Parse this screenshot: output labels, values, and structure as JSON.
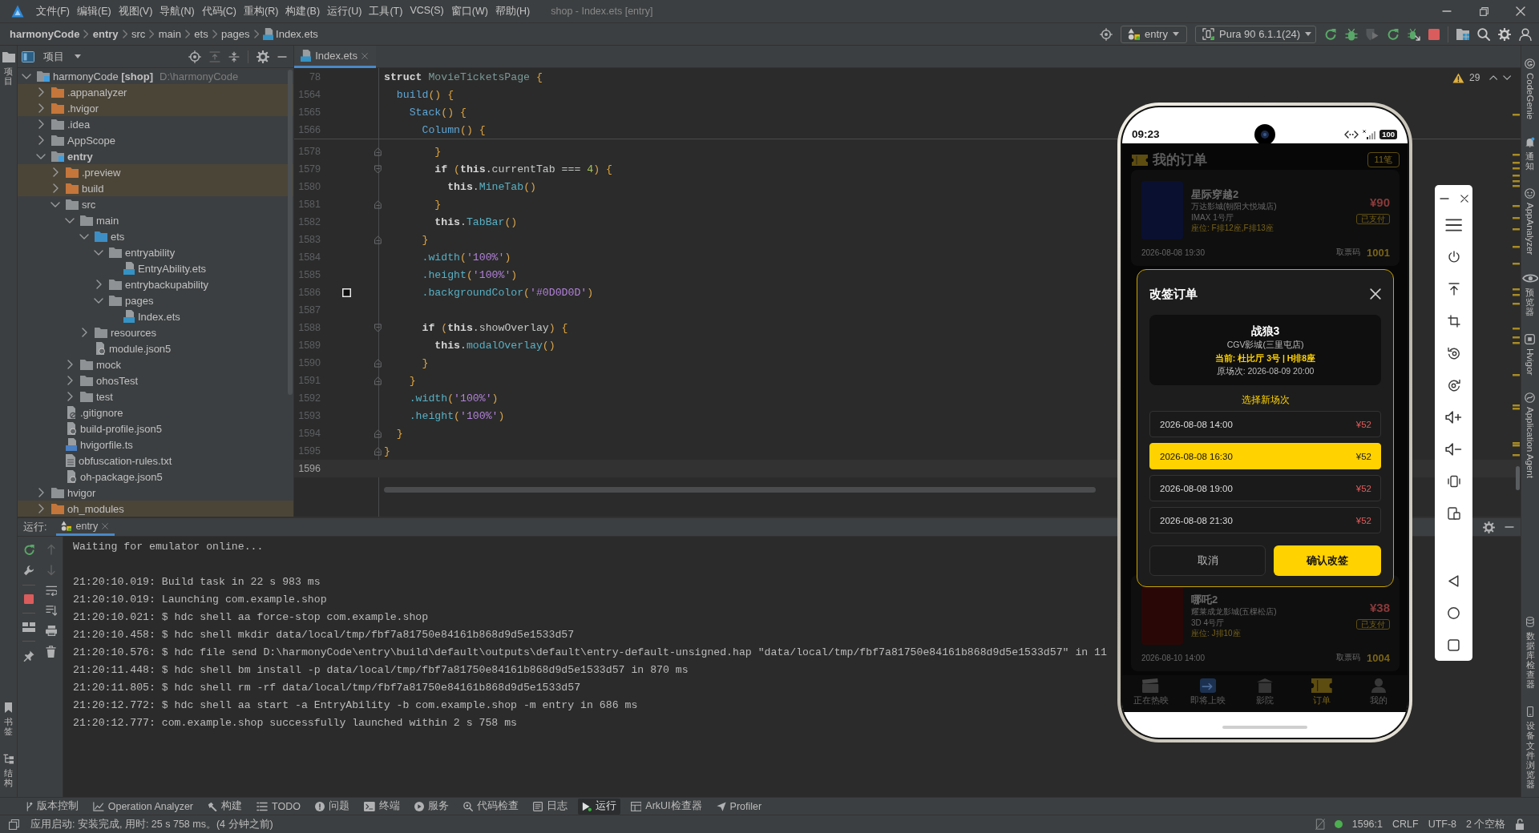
{
  "title_bar": {
    "menu": [
      "文件(F)",
      "编辑(E)",
      "视图(V)",
      "导航(N)",
      "代码(C)",
      "重构(R)",
      "构建(B)",
      "运行(U)",
      "工具(T)",
      "VCS(S)",
      "窗口(W)",
      "帮助(H)"
    ],
    "title": "shop - Index.ets [entry]"
  },
  "nav_bar": {
    "breadcrumb": [
      {
        "label": "harmonyCode",
        "kind": "project"
      },
      {
        "label": "entry",
        "kind": "module"
      },
      {
        "label": "src",
        "kind": "folder"
      },
      {
        "label": "main",
        "kind": "folder"
      },
      {
        "label": "ets",
        "kind": "folder"
      },
      {
        "label": "pages",
        "kind": "folder"
      },
      {
        "label": "Index.ets",
        "kind": "ets-file"
      }
    ],
    "run_config": "entry",
    "device": "Pura 90 6.1.1(24)"
  },
  "left_strip": {
    "top": [
      {
        "label": "项目",
        "kind": "project"
      }
    ],
    "bottom": [
      {
        "label": "书签",
        "kind": "bookmarks"
      },
      {
        "label": "结构",
        "kind": "structure"
      }
    ]
  },
  "project_panel": {
    "title": "项目",
    "tree": [
      {
        "label": "harmonyCode **[shop]**",
        "path": "D:\\harmonyCode",
        "kind": "project",
        "expanded": true,
        "excluded": false,
        "children": [
          {
            "label": ".appanalyzer",
            "kind": "folder",
            "expanded": false,
            "excluded": true
          },
          {
            "label": ".hvigor",
            "kind": "folder",
            "expanded": false,
            "excluded": true
          },
          {
            "label": ".idea",
            "kind": "folder",
            "expanded": false,
            "excluded": false
          },
          {
            "label": "AppScope",
            "kind": "folder",
            "expanded": false,
            "excluded": false
          },
          {
            "label": "entry",
            "kind": "module",
            "expanded": true,
            "excluded": false,
            "children": [
              {
                "label": ".preview",
                "kind": "folder",
                "expanded": false,
                "excluded": true
              },
              {
                "label": "build",
                "kind": "folder",
                "expanded": false,
                "excluded": true
              },
              {
                "label": "src",
                "kind": "folder",
                "expanded": true,
                "excluded": false,
                "children": [
                  {
                    "label": "main",
                    "kind": "folder",
                    "expanded": true,
                    "excluded": false,
                    "children": [
                      {
                        "label": "ets",
                        "kind": "source-folder",
                        "expanded": true,
                        "excluded": false,
                        "children": [
                          {
                            "label": "entryability",
                            "kind": "folder",
                            "expanded": true,
                            "excluded": false,
                            "children": [
                              {
                                "label": "EntryAbility.ets",
                                "kind": "ets-file",
                                "excluded": false
                              }
                            ]
                          },
                          {
                            "label": "entrybackupability",
                            "kind": "folder",
                            "expanded": false,
                            "excluded": false
                          },
                          {
                            "label": "pages",
                            "kind": "folder",
                            "expanded": true,
                            "excluded": false,
                            "children": [
                              {
                                "label": "Index.ets",
                                "kind": "ets-file",
                                "excluded": false
                              }
                            ]
                          }
                        ]
                      },
                      {
                        "label": "resources",
                        "kind": "folder",
                        "expanded": false,
                        "excluded": false
                      },
                      {
                        "label": "module.json5",
                        "kind": "json5-file",
                        "excluded": false
                      }
                    ]
                  },
                  {
                    "label": "mock",
                    "kind": "folder",
                    "expanded": false,
                    "excluded": false
                  },
                  {
                    "label": "ohosTest",
                    "kind": "folder",
                    "expanded": false,
                    "excluded": false
                  },
                  {
                    "label": "test",
                    "kind": "folder",
                    "expanded": false,
                    "excluded": false
                  }
                ]
              },
              {
                "label": ".gitignore",
                "kind": "ignore-file",
                "excluded": false
              },
              {
                "label": "build-profile.json5",
                "kind": "json5-file",
                "excluded": false
              },
              {
                "label": "hvigorfile.ts",
                "kind": "ts-file",
                "excluded": false
              },
              {
                "label": "obfuscation-rules.txt",
                "kind": "text-file",
                "excluded": false
              },
              {
                "label": "oh-package.json5",
                "kind": "json5-file",
                "excluded": false
              }
            ]
          },
          {
            "label": "hvigor",
            "kind": "folder",
            "expanded": false,
            "excluded": false
          },
          {
            "label": "oh_modules",
            "kind": "folder",
            "expanded": false,
            "excluded": true
          }
        ]
      }
    ]
  },
  "editor": {
    "tabs": [
      {
        "label": "Index.ets",
        "selected": true
      }
    ],
    "warnings": "29",
    "sticky_lines": [
      {
        "number": "78",
        "current": false,
        "tokens": [
          {
            "text": "struct ",
            "kind": "keyword"
          },
          {
            "text": "MovieTicketsPage ",
            "kind": "type"
          },
          {
            "text": "{",
            "kind": "brace"
          }
        ]
      },
      {
        "number": "1564",
        "current": false,
        "tokens": [
          {
            "text": "  build",
            "kind": "function"
          },
          {
            "text": "() ",
            "kind": "paren"
          },
          {
            "text": "{",
            "kind": "brace"
          }
        ]
      },
      {
        "number": "1565",
        "current": false,
        "tokens": [
          {
            "text": "    Stack",
            "kind": "function"
          },
          {
            "text": "() ",
            "kind": "paren"
          },
          {
            "text": "{",
            "kind": "brace"
          }
        ]
      },
      {
        "number": "1566",
        "current": false,
        "tokens": [
          {
            "text": "      Column",
            "kind": "function"
          },
          {
            "text": "() ",
            "kind": "paren"
          },
          {
            "text": "{",
            "kind": "brace"
          }
        ]
      }
    ],
    "lines": [
      {
        "number": "1578",
        "current": false,
        "fold_start": false,
        "fold_end": true,
        "tokens": [
          {
            "text": "        }",
            "kind": "brace"
          }
        ]
      },
      {
        "number": "1579",
        "current": false,
        "fold_start": true,
        "fold_end": false,
        "tokens": [
          {
            "text": "        if ",
            "kind": "keyword"
          },
          {
            "text": "(",
            "kind": "paren"
          },
          {
            "text": "this",
            "kind": "keyword"
          },
          {
            "text": ".currentTab === ",
            "kind": "plain"
          },
          {
            "text": "4",
            "kind": "number"
          },
          {
            "text": ") ",
            "kind": "paren"
          },
          {
            "text": "{",
            "kind": "brace"
          }
        ]
      },
      {
        "number": "1580",
        "current": false,
        "fold_start": false,
        "fold_end": false,
        "tokens": [
          {
            "text": "          this",
            "kind": "keyword"
          },
          {
            "text": ".",
            "kind": "plain"
          },
          {
            "text": "MineTab",
            "kind": "method"
          },
          {
            "text": "()",
            "kind": "paren"
          }
        ]
      },
      {
        "number": "1581",
        "current": false,
        "fold_start": false,
        "fold_end": true,
        "tokens": [
          {
            "text": "        }",
            "kind": "brace"
          }
        ]
      },
      {
        "number": "1582",
        "current": false,
        "fold_start": false,
        "fold_end": false,
        "tokens": [
          {
            "text": "        this",
            "kind": "keyword"
          },
          {
            "text": ".",
            "kind": "plain"
          },
          {
            "text": "TabBar",
            "kind": "method"
          },
          {
            "text": "()",
            "kind": "paren"
          }
        ]
      },
      {
        "number": "1583",
        "current": false,
        "fold_start": false,
        "fold_end": true,
        "tokens": [
          {
            "text": "      }",
            "kind": "brace"
          }
        ]
      },
      {
        "number": "1584",
        "current": false,
        "fold_start": false,
        "fold_end": false,
        "tokens": [
          {
            "text": "      .width",
            "kind": "method"
          },
          {
            "text": "(",
            "kind": "paren"
          },
          {
            "text": "'100%'",
            "kind": "string"
          },
          {
            "text": ")",
            "kind": "paren"
          }
        ]
      },
      {
        "number": "1585",
        "current": false,
        "fold_start": false,
        "fold_end": false,
        "tokens": [
          {
            "text": "      .height",
            "kind": "method"
          },
          {
            "text": "(",
            "kind": "paren"
          },
          {
            "text": "'100%'",
            "kind": "string"
          },
          {
            "text": ")",
            "kind": "paren"
          }
        ]
      },
      {
        "number": "1586",
        "current": false,
        "fold_start": false,
        "fold_end": false,
        "color": "#0d0d0d",
        "tokens": [
          {
            "text": "      .backgroundColor",
            "kind": "method"
          },
          {
            "text": "(",
            "kind": "paren"
          },
          {
            "text": "'#0D0D0D'",
            "kind": "string"
          },
          {
            "text": ")",
            "kind": "paren"
          }
        ]
      },
      {
        "number": "1587",
        "current": false,
        "fold_start": false,
        "fold_end": false
      },
      {
        "number": "1588",
        "current": false,
        "fold_start": true,
        "fold_end": false,
        "tokens": [
          {
            "text": "      if ",
            "kind": "keyword"
          },
          {
            "text": "(",
            "kind": "paren"
          },
          {
            "text": "this",
            "kind": "keyword"
          },
          {
            "text": ".showOverlay",
            "kind": "plain"
          },
          {
            "text": ") ",
            "kind": "paren"
          },
          {
            "text": "{",
            "kind": "brace"
          }
        ]
      },
      {
        "number": "1589",
        "current": false,
        "fold_start": false,
        "fold_end": false,
        "tokens": [
          {
            "text": "        this",
            "kind": "keyword"
          },
          {
            "text": ".",
            "kind": "plain"
          },
          {
            "text": "modalOverlay",
            "kind": "method"
          },
          {
            "text": "()",
            "kind": "paren"
          }
        ]
      },
      {
        "number": "1590",
        "current": false,
        "fold_start": false,
        "fold_end": true,
        "tokens": [
          {
            "text": "      }",
            "kind": "brace"
          }
        ]
      },
      {
        "number": "1591",
        "current": false,
        "fold_start": false,
        "fold_end": true,
        "tokens": [
          {
            "text": "    }",
            "kind": "brace"
          }
        ]
      },
      {
        "number": "1592",
        "current": false,
        "fold_start": false,
        "fold_end": false,
        "tokens": [
          {
            "text": "    .width",
            "kind": "method"
          },
          {
            "text": "(",
            "kind": "paren"
          },
          {
            "text": "'100%'",
            "kind": "string"
          },
          {
            "text": ")",
            "kind": "paren"
          }
        ]
      },
      {
        "number": "1593",
        "current": false,
        "fold_start": false,
        "fold_end": false,
        "tokens": [
          {
            "text": "    .height",
            "kind": "method"
          },
          {
            "text": "(",
            "kind": "paren"
          },
          {
            "text": "'100%'",
            "kind": "string"
          },
          {
            "text": ")",
            "kind": "paren"
          }
        ]
      },
      {
        "number": "1594",
        "current": false,
        "fold_start": false,
        "fold_end": true,
        "tokens": [
          {
            "text": "  }",
            "kind": "brace"
          }
        ]
      },
      {
        "number": "1595",
        "current": false,
        "fold_start": false,
        "fold_end": true,
        "tokens": [
          {
            "text": "}",
            "kind": "brace"
          }
        ]
      },
      {
        "number": "1596",
        "current": true,
        "fold_start": false,
        "fold_end": false
      }
    ]
  },
  "run_panel": {
    "label": "运行:",
    "tabs": [
      {
        "label": "entry",
        "selected": true
      }
    ],
    "output": [
      [
        "Waiting for emulator online..."
      ],
      [
        "21:20:10.019: Build task in 22 s 983 ms",
        "21:20:10.019: Launching com.example.shop",
        "21:20:10.021: $ hdc shell aa force-stop com.example.shop",
        "21:20:10.458: $ hdc shell mkdir data/local/tmp/fbf7a81750e84161b868d9d5e1533d57",
        "21:20:10.576: $ hdc file send D:\\harmonyCode\\entry\\build\\default\\outputs\\default\\entry-default-unsigned.hap \"data/local/tmp/fbf7a81750e84161b868d9d5e1533d57\" in 11",
        "21:20:11.448: $ hdc shell bm install -p data/local/tmp/fbf7a81750e84161b868d9d5e1533d57 in 870 ms",
        "21:20:11.805: $ hdc shell rm -rf data/local/tmp/fbf7a81750e84161b868d9d5e1533d57",
        "21:20:12.772: $ hdc shell aa start -a EntryAbility -b com.example.shop -m entry in 686 ms",
        "21:20:12.777: com.example.shop successfully launched within 2 s 758 ms"
      ]
    ]
  },
  "emulator": {
    "status_bar": {
      "time": "09:23",
      "battery": "100"
    },
    "app": {
      "title": "我的订单",
      "count": "11笔",
      "orders": [
        {
          "movie": "星际穿越2",
          "cinema": "万达影城(朝阳大悦城店)",
          "hall": "IMAX 1号厅",
          "seats": "座位: F排12座,F排13座",
          "price": "¥90",
          "status": "已支付",
          "showtime": "2026-08-08 19:30",
          "code_label": "取票码",
          "code": "1001",
          "color": "#0a1030"
        },
        {
          "movie": "哪吒2",
          "cinema": "耀莱成龙影城(五棵松店)",
          "hall": "3D 4号厅",
          "seats": "座位: J排10座",
          "price": "¥38",
          "status": "已支付",
          "showtime": "2026-08-10 14:00",
          "code_label": "取票码",
          "code": "1004",
          "color": "#2a0707"
        }
      ],
      "tabs": [
        {
          "label": "正在热映",
          "kind": "now-showing",
          "selected": false
        },
        {
          "label": "即将上映",
          "kind": "coming-soon",
          "selected": false
        },
        {
          "label": "影院",
          "kind": "cinemas",
          "selected": false
        },
        {
          "label": "订单",
          "kind": "orders",
          "selected": true
        },
        {
          "label": "我的",
          "kind": "profile",
          "selected": false
        }
      ]
    },
    "dialog": {
      "title": "改签订单",
      "movie": "战狼3",
      "cinema": "CGV影城(三里屯店)",
      "current": "当前: 杜比厅 3号 | H排8座",
      "original": "原场次: 2026-08-09 20:00",
      "prompt": "选择新场次",
      "sessions": [
        {
          "time": "2026-08-08 14:00",
          "price": "¥52",
          "selected": false
        },
        {
          "time": "2026-08-08 16:30",
          "price": "¥52",
          "selected": true
        },
        {
          "time": "2026-08-08 19:00",
          "price": "¥52",
          "selected": false
        },
        {
          "time": "2026-08-08 21:30",
          "price": "¥52",
          "selected": false
        }
      ],
      "buttons": [
        {
          "label": "取消",
          "kind": "secondary"
        },
        {
          "label": "确认改签",
          "kind": "primary"
        }
      ]
    }
  },
  "right_strip": {
    "top": [
      {
        "label": "CodeGenie",
        "kind": "codegenie"
      },
      {
        "label": "通知",
        "kind": "notifications"
      },
      {
        "label": "AppAnalyzer",
        "kind": "appanalyzer"
      },
      {
        "label": "预览器",
        "kind": "previewer"
      },
      {
        "label": "Hvigor",
        "kind": "hvigor"
      },
      {
        "label": "Application Agent",
        "kind": "agent"
      }
    ],
    "bottom": [
      {
        "label": "数据库检查器",
        "kind": "database"
      },
      {
        "label": "设备文件浏览器",
        "kind": "device-files"
      }
    ]
  },
  "tool_window_bar": [
    {
      "label": "版本控制",
      "kind": "vcs",
      "selected": false
    },
    {
      "label": "Operation Analyzer",
      "kind": "analyzer",
      "selected": false
    },
    {
      "label": "构建",
      "kind": "build",
      "selected": false
    },
    {
      "label": "TODO",
      "kind": "todo",
      "selected": false
    },
    {
      "label": "问题",
      "kind": "problems",
      "selected": false
    },
    {
      "label": "终端",
      "kind": "terminal",
      "selected": false
    },
    {
      "label": "服务",
      "kind": "services",
      "selected": false
    },
    {
      "label": "代码检查",
      "kind": "inspection",
      "selected": false
    },
    {
      "label": "日志",
      "kind": "log",
      "selected": false
    },
    {
      "label": "运行",
      "kind": "run",
      "selected": true
    },
    {
      "label": "ArkUI检查器",
      "kind": "arkui",
      "selected": false
    },
    {
      "label": "Profiler",
      "kind": "profiler",
      "selected": false
    }
  ],
  "status_bar": {
    "message": "应用启动: 安装完成, 用时: 25 s 758 ms。(4 分钟之前)",
    "position": "1596:1",
    "line_separator": "CRLF",
    "encoding": "UTF-8",
    "indent": "2 个空格"
  }
}
